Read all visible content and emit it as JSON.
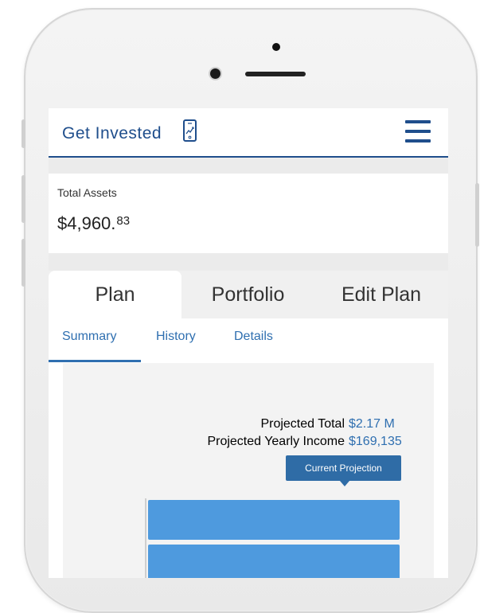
{
  "app": {
    "brand": "Get Invested"
  },
  "assets": {
    "label": "Total Assets",
    "value_main": "$4,960.",
    "value_cents": "83"
  },
  "tabs": [
    {
      "label": "Plan",
      "active": true
    },
    {
      "label": "Portfolio",
      "active": false
    },
    {
      "label": "Edit Plan",
      "active": false
    }
  ],
  "subtabs": [
    {
      "label": "Summary",
      "active": true
    },
    {
      "label": "History",
      "active": false
    },
    {
      "label": "Details",
      "active": false
    }
  ],
  "projection": {
    "total_label": "Projected Total",
    "total_value": "$2.17 M",
    "income_label": "Projected Yearly Income",
    "income_value": "$169,135",
    "tooltip": "Current Projection"
  },
  "colors": {
    "brand": "#1f4e8c",
    "link": "#2f6fb0",
    "bar": "#4e9ade"
  },
  "icons": {
    "brand_icon": "phone-chart-icon",
    "menu_icon": "hamburger-menu-icon"
  }
}
